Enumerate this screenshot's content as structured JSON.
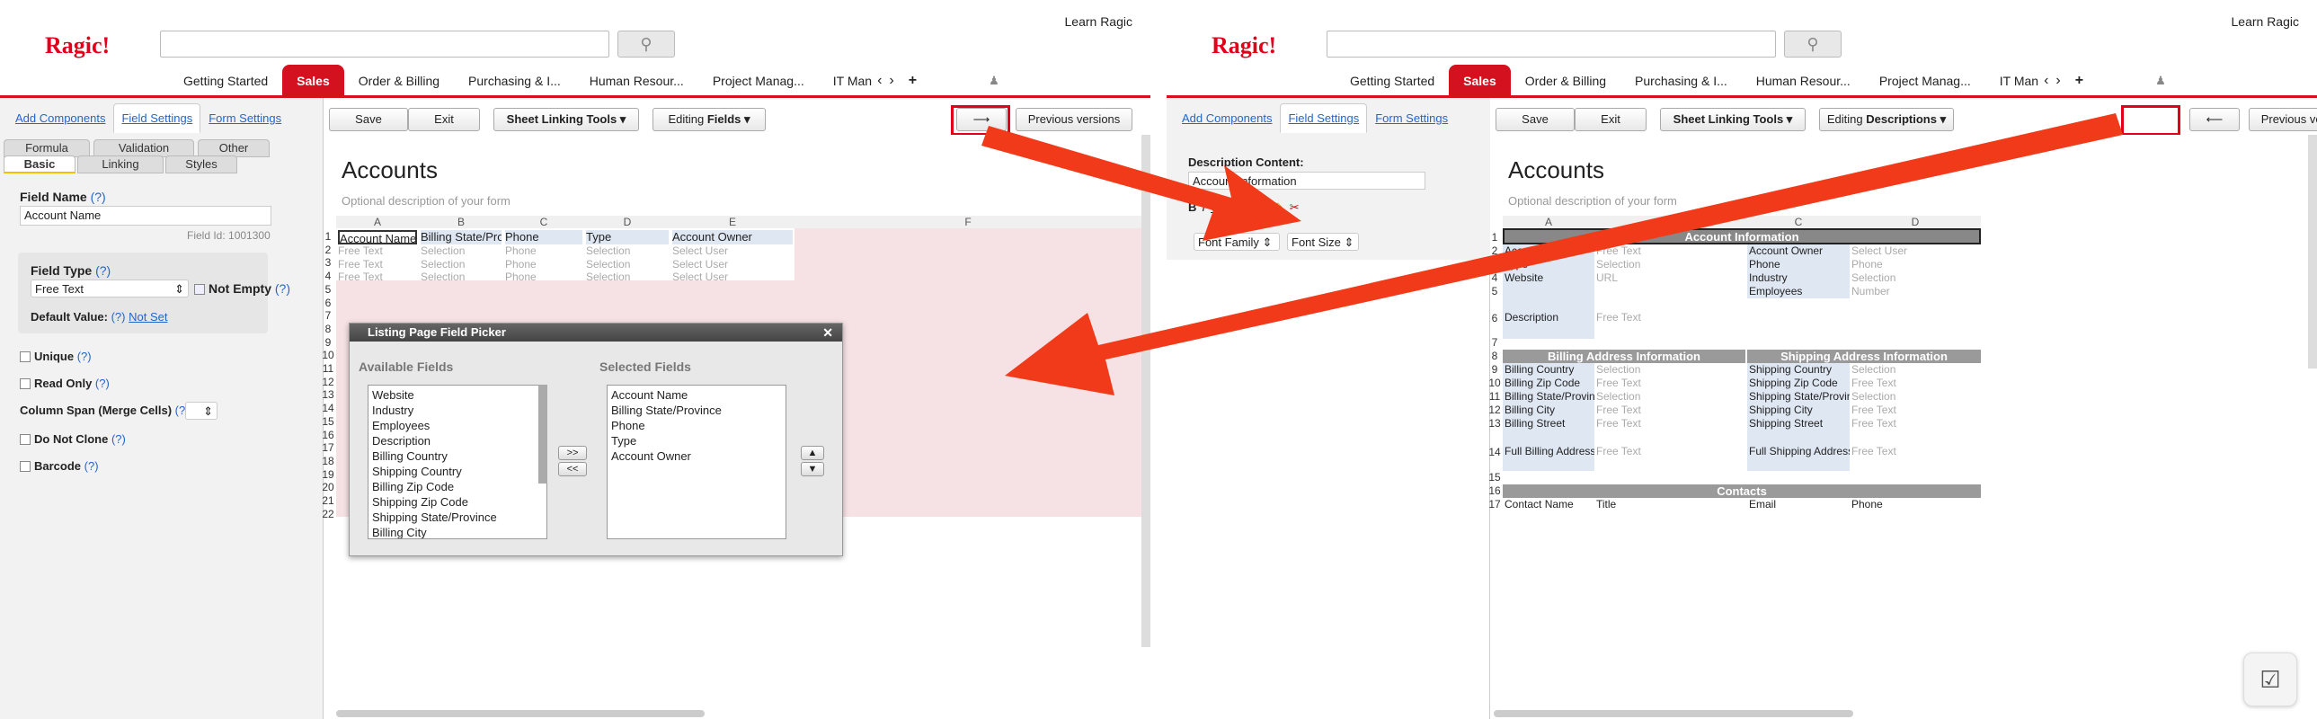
{
  "common": {
    "logo": "Ragic!",
    "learn": "Learn Ragic",
    "search_icon": "search-icon",
    "tabs": [
      "Getting Started",
      "Sales",
      "Order & Billing",
      "Purchasing & I...",
      "Human Resour...",
      "Project Manag...",
      "IT Man"
    ],
    "active_tab": "Sales",
    "left_tabs": [
      "Add Components",
      "Field Settings",
      "Form Settings"
    ],
    "buttons": {
      "save": "Save",
      "exit": "Exit",
      "linking": "Sheet Linking Tools ▾",
      "editing_prefix": "Editing ",
      "prev": "Previous versions"
    },
    "form_title": "Accounts",
    "form_desc": "Optional description of your form",
    "accent": "#d4111e"
  },
  "panel1": {
    "editing_mode": "Fields ▾",
    "toggle_arrow": "⟶",
    "subtabs_top": [
      "Formula",
      "Validation",
      "Other"
    ],
    "subtabs_bottom": [
      "Basic",
      "Linking",
      "Styles"
    ],
    "field_name_label": "Field Name",
    "field_name_value": "Account Name",
    "field_id": "Field Id: 1001300",
    "field_type_label": "Field Type",
    "field_type_value": "Free Text",
    "not_empty": "Not Empty",
    "default_label": "Default Value:",
    "not_set": "Not Set",
    "help": "(?)",
    "unique": "Unique",
    "read_only": "Read Only",
    "col_span": "Column Span (Merge Cells)",
    "do_not_clone": "Do Not Clone",
    "barcode": "Barcode",
    "columns": [
      "A",
      "B",
      "C",
      "D",
      "E",
      "F"
    ],
    "headers": [
      "Account Name",
      "Billing State/Province",
      "Phone",
      "Type",
      "Account Owner"
    ],
    "placeholders": [
      "Free Text",
      "Selection",
      "Phone",
      "Selection",
      "Select User"
    ],
    "rows": [
      "1",
      "2",
      "3",
      "4",
      "5",
      "6",
      "7",
      "8",
      "9",
      "10",
      "11",
      "12",
      "13",
      "14",
      "15",
      "16",
      "17",
      "18",
      "19",
      "20",
      "21",
      "22"
    ],
    "picker": {
      "title": "Listing Page Field Picker",
      "close": "✕",
      "available_label": "Available Fields",
      "selected_label": "Selected Fields",
      "available": [
        "Website",
        "Industry",
        "Employees",
        "Description",
        "Billing Country",
        "Shipping Country",
        "Billing Zip Code",
        "Shipping Zip Code",
        "Shipping State/Province",
        "Billing City"
      ],
      "selected": [
        "Account Name",
        "Billing State/Province",
        "Phone",
        "Type",
        "Account Owner"
      ],
      "add": ">>",
      "remove": "<<",
      "up": "▲",
      "down": "▼"
    }
  },
  "panel2": {
    "editing_mode": "Descriptions ▾",
    "toggle_arrow": "⟵",
    "desc_content_label": "Description Content:",
    "desc_content_value": "Account Information",
    "font_family": "Font Family ⇕",
    "font_size": "Font Size ⇕",
    "columns": [
      "A",
      "B",
      "C",
      "D"
    ],
    "rows": [
      "1",
      "2",
      "3",
      "4",
      "5",
      "6",
      "7",
      "8",
      "9",
      "10",
      "11",
      "12",
      "13",
      "14",
      "15",
      "16",
      "17"
    ],
    "band1": "Account Information",
    "band2": "Billing Address Information",
    "band3": "Shipping Address Information",
    "band4": "Contacts",
    "labels_a": {
      "r2": "Account Name",
      "r3": "Type",
      "r4": "Website",
      "r6": "Description",
      "r9": "Billing Country",
      "r10": "Billing Zip Code",
      "r11": "Billing State/Province",
      "r12": "Billing City",
      "r13": "Billing Street",
      "r14": "Full Billing Address",
      "r17": "Contact Name"
    },
    "values_b": {
      "r2": "Free Text",
      "r3": "Selection",
      "r4": "URL",
      "r6": "Free Text",
      "r9": "Selection",
      "r10": "Free Text",
      "r11": "Selection",
      "r12": "Free Text",
      "r13": "Free Text",
      "r14": "Free Text",
      "r17": "Title"
    },
    "labels_c": {
      "r2": "Account Owner",
      "r3": "Phone",
      "r4": "Industry",
      "r5": "Employees",
      "r9": "Shipping Country",
      "r10": "Shipping Zip Code",
      "r11": "Shipping State/Province",
      "r12": "Shipping City",
      "r13": "Shipping Street",
      "r14": "Full Shipping Address",
      "r17": "Email"
    },
    "values_d": {
      "r2": "Select User",
      "r3": "Phone",
      "r4": "Selection",
      "r5": "Number",
      "r9": "Selection",
      "r10": "Free Text",
      "r11": "Selection",
      "r12": "Free Text",
      "r13": "Free Text",
      "r14": "Free Text",
      "r17": "Phone"
    }
  }
}
